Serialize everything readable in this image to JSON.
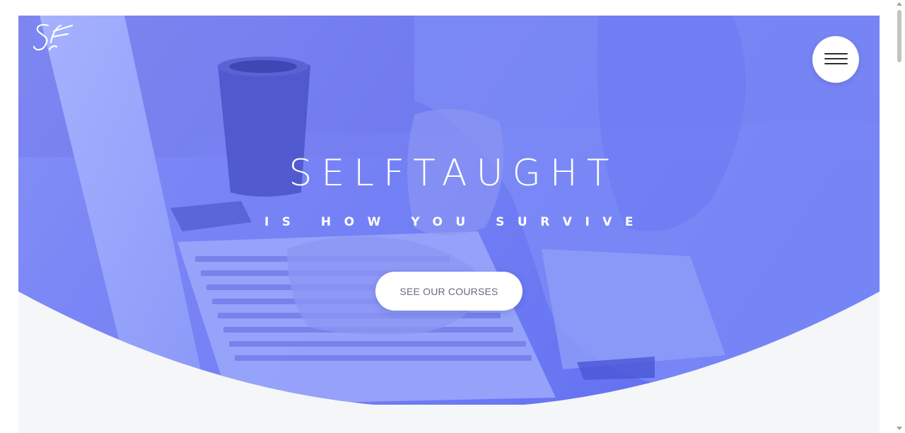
{
  "brand": {
    "logo_text": "SF"
  },
  "header": {
    "menu_icon": "hamburger-icon"
  },
  "hero": {
    "title": "SELFTAUGHT",
    "subtitle": "IS HOW YOU SURVIVE",
    "cta_label": "SEE OUR COURSES"
  },
  "colors": {
    "hero_overlay": "#5b6cf2",
    "page_background": "#f5f6f8",
    "button_background": "#ffffff",
    "button_text": "#6b6b7b"
  }
}
